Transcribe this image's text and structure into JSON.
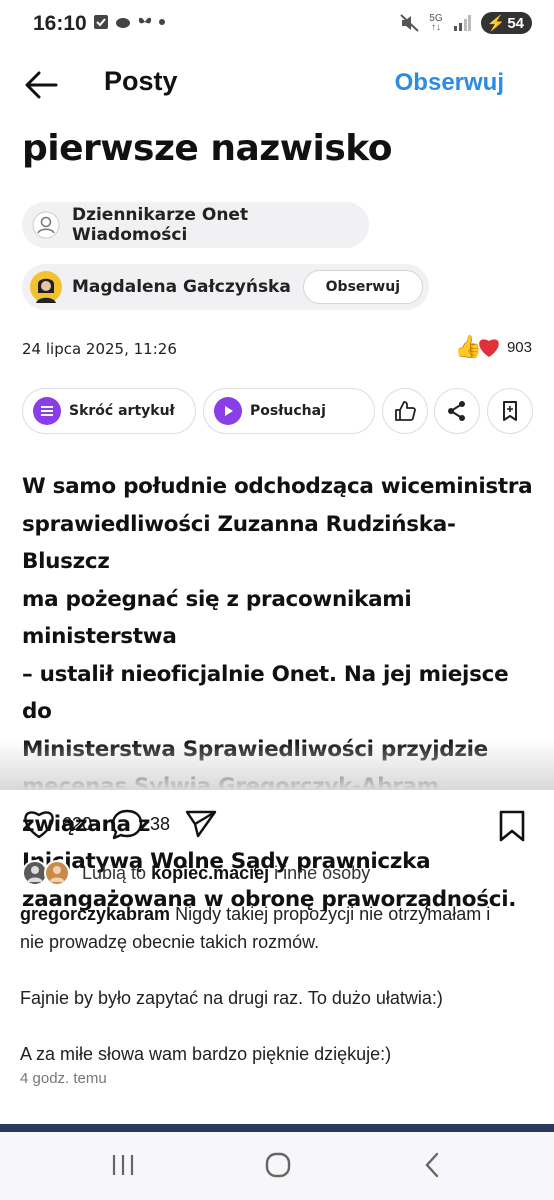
{
  "status_bar": {
    "time": "16:10",
    "network": "5G",
    "battery": "54"
  },
  "header": {
    "title": "Posty",
    "follow_label": "Obserwuj"
  },
  "article": {
    "headline_fragment": "pierwsze nazwisko",
    "author_org": "Dziennikarze Onet Wiadomości",
    "author_person": "Magdalena Gałczyńska",
    "author_follow_label": "Obserwuj",
    "date": "24 lipca 2025, 11:26",
    "reaction_count": "903",
    "tools": {
      "summarize_label": "Skróć artykuł",
      "listen_label": "Posłuchaj"
    },
    "lead_lines": [
      "W samo południe odchodząca wiceministra",
      "sprawiedliwości Zuzanna Rudzińska-Bluszcz",
      "ma pożegnać się z pracownikami ministerstwa",
      "– ustalił nieoficjalnie Onet. Na jej miejsce do",
      "Ministerstwa Sprawiedliwości przyjdzie",
      "mecenas Sylwia Gregorczyk-Abram, związana z",
      "Inicjatywą Wolne Sądy prawniczka",
      "zaangażowana w obronę praworządności."
    ]
  },
  "post": {
    "like_count": "620",
    "comment_count": "38",
    "liked_by_prefix": "Lubią to",
    "liked_by_user": "kopiec.maciej",
    "liked_by_suffix": "i inne osoby",
    "caption_user": "gregorczykabram",
    "caption_line1": "Nigdy takiej propozycji nie otrzymałam i",
    "caption_line2": "nie prowadzę obecnie takich rozmów.",
    "caption_para2": "Fajnie by było zapytać na drugi raz. To dużo ułatwia:)",
    "caption_para3": "A za miłe słowa wam bardzo pięknie dziękuje:)",
    "time_ago": "4 godz. temu"
  },
  "colors": {
    "accent_blue": "#2b8ce6",
    "purple": "#8a3ee8",
    "heart_red": "#e0303a"
  }
}
